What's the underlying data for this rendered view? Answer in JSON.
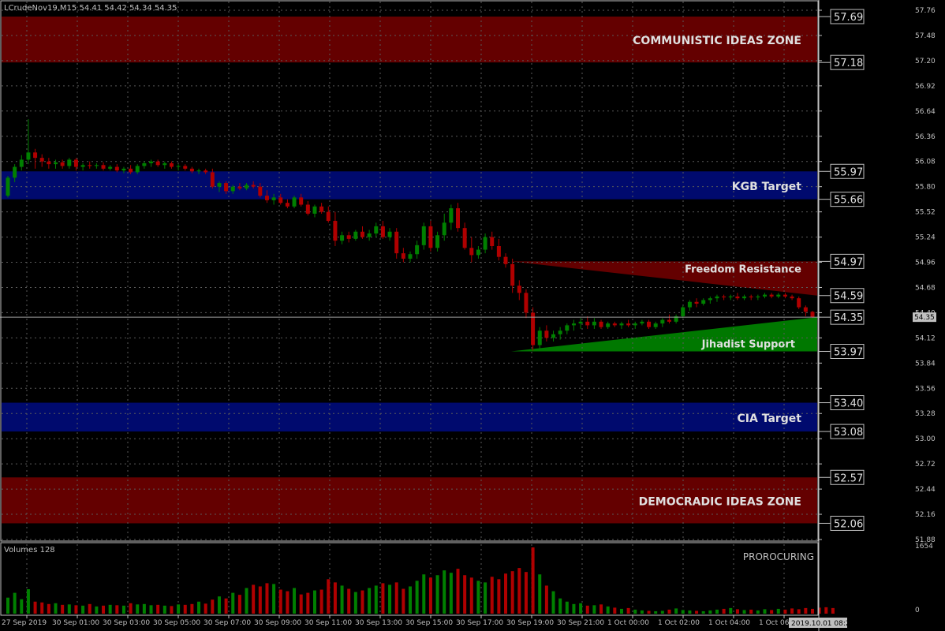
{
  "symbol_info": "LCrudeNov19,M15  54.41 54.42 54.34 54.35",
  "current_price": "54.35",
  "volume_label": "Volumes 128",
  "volume_scale": {
    "max_label": "1654",
    "min_label": "0",
    "max": 1654
  },
  "watermark": "PROROCURING",
  "time_box": "2019.10.01 08:22",
  "colors": {
    "background": "#000000",
    "bull": "#008000",
    "bear": "#B00000",
    "zone_red": "#640000",
    "zone_blue": "#000A6E",
    "support_green": "#007800",
    "resistance_red": "#640000",
    "grid": "#5a5a5a",
    "axis_text": "#C0C0C0"
  },
  "zones": [
    {
      "name": "COMMUNISTIC IDEAS ZONE",
      "top": "57.69",
      "bottom": "57.18",
      "color": "#640000"
    },
    {
      "name": "KGB Target",
      "top": "55.97",
      "bottom": "55.66",
      "color": "#000A6E"
    },
    {
      "name": "CIA Target",
      "top": "53.40",
      "bottom": "53.08",
      "color": "#000A6E"
    },
    {
      "name": "DEMOCRADIC IDEAS ZONE",
      "top": "52.57",
      "bottom": "52.06",
      "color": "#640000"
    }
  ],
  "triangles": [
    {
      "name": "Freedom Resistance",
      "top_label": "54.97",
      "bottom_label": "54.59"
    },
    {
      "name": "Jihadist Support",
      "top_label": "54.35",
      "bottom_label": "53.97"
    }
  ],
  "chart_data": {
    "type": "candlestick",
    "timeframe": "M15",
    "y_axis_ticks": [
      "57.76",
      "57.48",
      "57.20",
      "56.92",
      "56.64",
      "56.36",
      "56.08",
      "55.80",
      "55.52",
      "55.24",
      "54.96",
      "54.68",
      "54.40",
      "54.12",
      "53.84",
      "53.56",
      "53.28",
      "53.00",
      "52.72",
      "52.44",
      "52.16",
      "51.88"
    ],
    "ylim": [
      51.82,
      57.82
    ],
    "x_axis_ticks": [
      "27 Sep 2019",
      "30 Sep 01:00",
      "30 Sep 03:00",
      "30 Sep 05:00",
      "30 Sep 07:00",
      "30 Sep 09:00",
      "30 Sep 11:00",
      "30 Sep 13:00",
      "30 Sep 15:00",
      "30 Sep 17:00",
      "30 Sep 19:00",
      "30 Sep 21:00",
      "1 Oct 00:00",
      "1 Oct 02:00",
      "1 Oct 04:00",
      "1 Oct 06:00"
    ],
    "candles": [
      [
        55.7,
        55.92,
        55.68,
        55.9
      ],
      [
        55.9,
        56.05,
        55.85,
        56.02
      ],
      [
        56.02,
        56.15,
        55.98,
        56.1
      ],
      [
        56.1,
        56.55,
        56.05,
        56.18
      ],
      [
        56.18,
        56.22,
        56.0,
        56.12
      ],
      [
        56.12,
        56.16,
        56.02,
        56.08
      ],
      [
        56.08,
        56.12,
        56.0,
        56.05
      ],
      [
        56.05,
        56.1,
        56.0,
        56.07
      ],
      [
        56.07,
        56.1,
        56.0,
        56.03
      ],
      [
        56.03,
        56.12,
        56.0,
        56.1
      ],
      [
        56.1,
        56.12,
        55.98,
        56.02
      ],
      [
        56.02,
        56.06,
        55.98,
        56.04
      ],
      [
        56.04,
        56.08,
        56.0,
        56.03
      ],
      [
        56.03,
        56.06,
        56.0,
        56.04
      ],
      [
        56.04,
        56.07,
        55.98,
        56.0
      ],
      [
        56.0,
        56.04,
        55.98,
        56.02
      ],
      [
        56.02,
        56.05,
        55.96,
        55.98
      ],
      [
        55.98,
        56.02,
        55.95,
        56.0
      ],
      [
        56.0,
        56.04,
        55.94,
        55.96
      ],
      [
        55.96,
        56.05,
        55.94,
        56.03
      ],
      [
        56.03,
        56.08,
        56.0,
        56.06
      ],
      [
        56.06,
        56.1,
        56.02,
        56.08
      ],
      [
        56.08,
        56.1,
        56.02,
        56.04
      ],
      [
        56.04,
        56.08,
        56.0,
        56.06
      ],
      [
        56.06,
        56.08,
        56.0,
        56.02
      ],
      [
        56.02,
        56.05,
        55.98,
        56.03
      ],
      [
        56.03,
        56.05,
        55.98,
        56.0
      ],
      [
        56.0,
        56.02,
        55.95,
        55.97
      ],
      [
        55.97,
        56.0,
        55.94,
        55.98
      ],
      [
        55.98,
        56.0,
        55.94,
        55.96
      ],
      [
        55.96,
        56.0,
        55.78,
        55.8
      ],
      [
        55.8,
        55.86,
        55.74,
        55.84
      ],
      [
        55.84,
        55.86,
        55.72,
        55.75
      ],
      [
        55.75,
        55.82,
        55.72,
        55.8
      ],
      [
        55.8,
        55.84,
        55.76,
        55.78
      ],
      [
        55.78,
        55.84,
        55.76,
        55.82
      ],
      [
        55.82,
        55.86,
        55.78,
        55.8
      ],
      [
        55.8,
        55.84,
        55.68,
        55.7
      ],
      [
        55.7,
        55.76,
        55.62,
        55.65
      ],
      [
        55.65,
        55.72,
        55.6,
        55.68
      ],
      [
        55.68,
        55.72,
        55.6,
        55.62
      ],
      [
        55.62,
        55.66,
        55.56,
        55.58
      ],
      [
        55.58,
        55.7,
        55.56,
        55.68
      ],
      [
        55.68,
        55.72,
        55.58,
        55.6
      ],
      [
        55.6,
        55.64,
        55.48,
        55.5
      ],
      [
        55.5,
        55.6,
        55.46,
        55.58
      ],
      [
        55.58,
        55.62,
        55.5,
        55.52
      ],
      [
        55.52,
        55.58,
        55.4,
        55.42
      ],
      [
        55.42,
        55.52,
        55.14,
        55.2
      ],
      [
        55.2,
        55.3,
        55.16,
        55.26
      ],
      [
        55.26,
        55.3,
        55.18,
        55.22
      ],
      [
        55.22,
        55.32,
        55.2,
        55.3
      ],
      [
        55.3,
        55.36,
        55.22,
        55.24
      ],
      [
        55.24,
        55.32,
        55.2,
        55.28
      ],
      [
        55.28,
        55.4,
        55.24,
        55.36
      ],
      [
        55.36,
        55.42,
        55.22,
        55.24
      ],
      [
        55.24,
        55.34,
        55.2,
        55.3
      ],
      [
        55.3,
        55.34,
        55.0,
        55.06
      ],
      [
        55.06,
        55.12,
        54.96,
        55.0
      ],
      [
        55.0,
        55.08,
        54.96,
        55.05
      ],
      [
        55.05,
        55.2,
        55.0,
        55.15
      ],
      [
        55.15,
        55.4,
        55.1,
        55.36
      ],
      [
        55.36,
        55.42,
        55.08,
        55.12
      ],
      [
        55.12,
        55.3,
        55.08,
        55.26
      ],
      [
        55.26,
        55.5,
        55.2,
        55.4
      ],
      [
        55.4,
        55.6,
        55.32,
        55.56
      ],
      [
        55.56,
        55.62,
        55.3,
        55.34
      ],
      [
        55.34,
        55.4,
        55.1,
        55.12
      ],
      [
        55.12,
        55.24,
        54.96,
        55.04
      ],
      [
        55.04,
        55.14,
        55.0,
        55.1
      ],
      [
        55.1,
        55.28,
        55.06,
        55.24
      ],
      [
        55.24,
        55.3,
        55.1,
        55.14
      ],
      [
        55.14,
        55.22,
        54.98,
        55.02
      ],
      [
        55.02,
        55.06,
        54.9,
        54.94
      ],
      [
        54.94,
        55.0,
        54.62,
        54.7
      ],
      [
        54.7,
        54.76,
        54.54,
        54.62
      ],
      [
        54.62,
        54.66,
        54.34,
        54.4
      ],
      [
        54.4,
        54.46,
        53.98,
        54.04
      ],
      [
        54.04,
        54.24,
        54.0,
        54.2
      ],
      [
        54.2,
        54.26,
        54.08,
        54.12
      ],
      [
        54.12,
        54.2,
        54.08,
        54.16
      ],
      [
        54.16,
        54.24,
        54.1,
        54.2
      ],
      [
        54.2,
        54.28,
        54.16,
        54.26
      ],
      [
        54.26,
        54.32,
        54.2,
        54.28
      ],
      [
        54.28,
        54.34,
        54.22,
        54.3
      ],
      [
        54.3,
        54.36,
        54.22,
        54.26
      ],
      [
        54.26,
        54.34,
        54.22,
        54.3
      ],
      [
        54.3,
        54.32,
        54.22,
        54.24
      ],
      [
        54.24,
        54.3,
        54.22,
        54.28
      ],
      [
        54.28,
        54.3,
        54.24,
        54.26
      ],
      [
        54.26,
        54.3,
        54.22,
        54.28
      ],
      [
        54.28,
        54.32,
        54.24,
        54.26
      ],
      [
        54.26,
        54.3,
        54.22,
        54.28
      ],
      [
        54.28,
        54.32,
        54.26,
        54.3
      ],
      [
        54.3,
        54.32,
        54.22,
        54.24
      ],
      [
        54.24,
        54.3,
        54.22,
        54.28
      ],
      [
        54.28,
        54.34,
        54.24,
        54.32
      ],
      [
        54.32,
        54.38,
        54.28,
        54.3
      ],
      [
        54.3,
        54.38,
        54.28,
        54.36
      ],
      [
        54.36,
        54.48,
        54.34,
        54.46
      ],
      [
        54.46,
        54.54,
        54.42,
        54.52
      ],
      [
        54.52,
        54.56,
        54.46,
        54.5
      ],
      [
        54.5,
        54.56,
        54.48,
        54.54
      ],
      [
        54.54,
        54.58,
        54.5,
        54.56
      ],
      [
        54.56,
        54.6,
        54.52,
        54.58
      ],
      [
        54.58,
        54.6,
        54.54,
        54.57
      ],
      [
        54.57,
        54.6,
        54.54,
        54.58
      ],
      [
        54.58,
        54.62,
        54.54,
        54.56
      ],
      [
        54.56,
        54.6,
        54.54,
        54.58
      ],
      [
        54.58,
        54.6,
        54.54,
        54.57
      ],
      [
        54.57,
        54.6,
        54.54,
        54.58
      ],
      [
        54.58,
        54.62,
        54.56,
        54.6
      ],
      [
        54.6,
        54.62,
        54.56,
        54.58
      ],
      [
        54.58,
        54.62,
        54.56,
        54.6
      ],
      [
        54.6,
        54.62,
        54.56,
        54.58
      ],
      [
        54.58,
        54.6,
        54.54,
        54.56
      ],
      [
        54.56,
        54.58,
        54.44,
        54.46
      ],
      [
        54.46,
        54.48,
        54.36,
        54.41
      ],
      [
        54.41,
        54.42,
        54.34,
        54.35
      ]
    ],
    "volumes": [
      400,
      520,
      360,
      610,
      300,
      280,
      240,
      260,
      220,
      230,
      210,
      200,
      240,
      180,
      200,
      220,
      210,
      200,
      260,
      230,
      240,
      210,
      220,
      200,
      190,
      230,
      220,
      240,
      300,
      250,
      350,
      430,
      380,
      520,
      470,
      640,
      720,
      680,
      760,
      740,
      600,
      560,
      640,
      480,
      520,
      580,
      600,
      860,
      780,
      700,
      620,
      540,
      580,
      640,
      700,
      760,
      720,
      780,
      620,
      680,
      820,
      980,
      900,
      960,
      1080,
      1020,
      1120,
      960,
      900,
      820,
      780,
      920,
      860,
      1000,
      1060,
      1140,
      1040,
      1654,
      980,
      700,
      560,
      380,
      300,
      240,
      260,
      200,
      210,
      230,
      180,
      150,
      120,
      140,
      100,
      80,
      70,
      60,
      70,
      100,
      130,
      90,
      80,
      70,
      60,
      80,
      100,
      120,
      140,
      110,
      90,
      100,
      80,
      110,
      90,
      120,
      100,
      130,
      110,
      140,
      120,
      150,
      160,
      140
    ]
  }
}
